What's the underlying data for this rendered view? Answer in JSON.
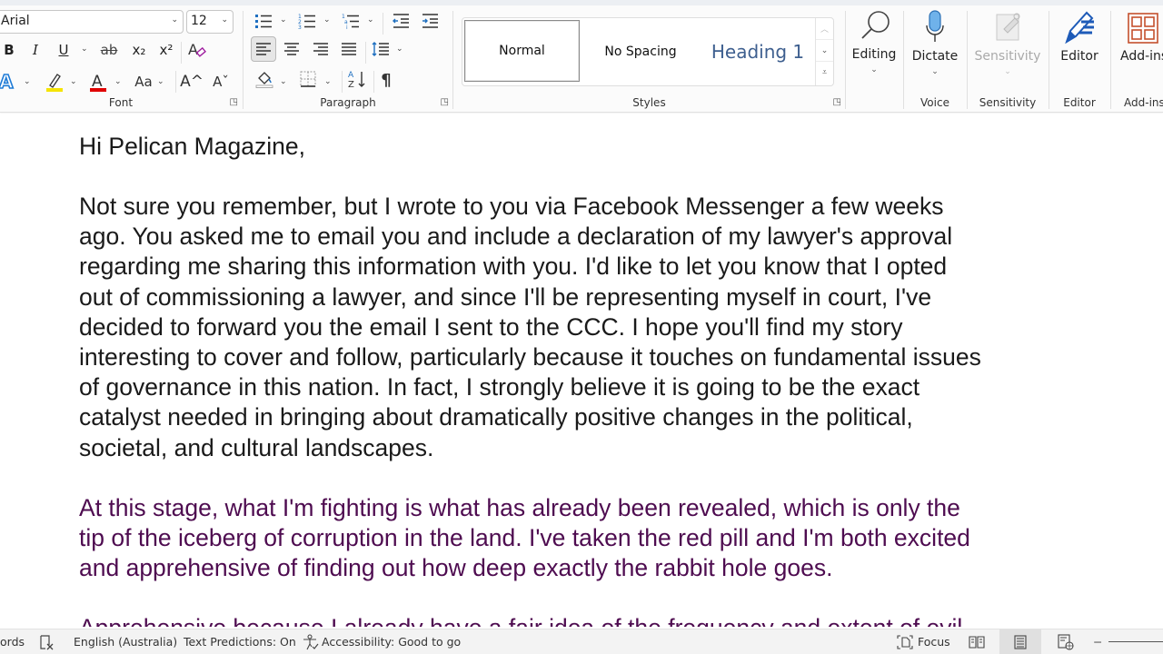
{
  "ribbon": {
    "font_group": {
      "label": "Font",
      "font_name": "Arial",
      "font_size": "12",
      "bold": "B",
      "italic": "I",
      "underline": "U",
      "strikethrough": "ab",
      "subscript": "x₂",
      "superscript": "x²",
      "clear_formatting_icon": "clear-formatting-icon",
      "text_effects": "A",
      "highlight_color": "#f5e400",
      "font_color": "#e00000",
      "change_case": "Aa",
      "grow_font": "A^",
      "shrink_font": "Aˇ"
    },
    "paragraph_group": {
      "label": "Paragraph",
      "show_hide": "¶"
    },
    "styles_group": {
      "label": "Styles",
      "styles": [
        {
          "name": "Normal",
          "selected": true
        },
        {
          "name": "No Spacing",
          "selected": false
        },
        {
          "name": "Heading 1",
          "selected": false
        }
      ]
    },
    "editing": {
      "label": "Editing"
    },
    "voice": {
      "button": "Dictate",
      "label": "Voice"
    },
    "sensitivity": {
      "button": "Sensitivity",
      "label": "Sensitivity"
    },
    "editor": {
      "button": "Editor",
      "label": "Editor"
    },
    "addins": {
      "button": "Add-ins",
      "label": "Add-ins"
    }
  },
  "document": {
    "greeting": "Hi Pelican Magazine,",
    "paragraph1": [
      "Not sure you remember, but I wrote to you via Facebook Messenger a few weeks",
      "ago. You asked me to email you and include a declaration of my lawyer's approval",
      "regarding me sharing this information with you. I'd like to let you know that I opted",
      "out of commissioning a lawyer, and since I'll be representing myself in court, I've",
      "decided to forward you the email I sent to the CCC. I hope you'll find my story",
      "interesting to cover and follow, particularly because it touches on fundamental issues",
      "of governance in this nation. In fact, I strongly believe it is going to be the exact",
      "catalyst needed in bringing about dramatically positive changes in the political,",
      "societal, and cultural landscapes."
    ],
    "paragraph2": [
      "At this stage, what I'm fighting is what has already been revealed, which is only the",
      "tip of the iceberg of corruption in the land. I've taken the red pill and I'm both excited",
      "and apprehensive of finding out how deep exactly the rabbit hole goes."
    ],
    "paragraph3_partial": "Apprehensive because I already have a fair idea of the frequency and extent of evil",
    "body_color": "#1a1a1a",
    "quote_color": "#4e0c50"
  },
  "statusbar": {
    "word_count": "ords",
    "language": "English (Australia)",
    "text_predictions": "Text Predictions: On",
    "accessibility": "Accessibility: Good to go",
    "focus": "Focus"
  }
}
